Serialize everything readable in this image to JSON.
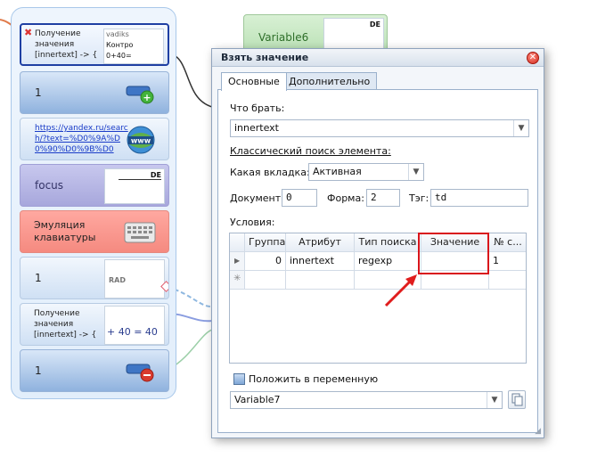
{
  "canvas": {
    "block1": {
      "label": "Получение значения [innertext] -> {",
      "preview": [
        "vadiks",
        "Контро",
        "0+40="
      ]
    },
    "block2": {
      "label": "1"
    },
    "block3": {
      "link": "https://yandex.ru/search/?text=%D0%9A%D0%90%D0%9B%D0"
    },
    "block4": {
      "label": "focus",
      "preview": "DE"
    },
    "block5": {
      "label": "Эмуляция клавиатуры"
    },
    "block6": {
      "label": "1",
      "preview": "RAD"
    },
    "block7": {
      "label": "Получение значения [innertext] -> {",
      "preview": "+ 40 = 40"
    },
    "block8": {
      "label": "1"
    },
    "variable6": {
      "label": "Variable6",
      "preview": "DE"
    }
  },
  "dialog": {
    "title": "Взять значение",
    "tabs": [
      "Основные",
      "Дополнительно"
    ],
    "what_to_take_label": "Что брать:",
    "what_to_take_value": "innertext",
    "classic_search_label": "Классический поиск элемента:",
    "which_tab_label": "Какая вкладка:",
    "which_tab_value": "Активная",
    "document_label": "Документ:",
    "document_value": "0",
    "form_label": "Форма:",
    "form_value": "2",
    "tag_label": "Тэг:",
    "tag_value": "td",
    "conditions_label": "Условия:",
    "grid": {
      "columns": [
        "Группа",
        "Атрибут",
        "Тип поиска",
        "Значение",
        "№ с..."
      ],
      "rows": [
        [
          "0",
          "innertext",
          "regexp",
          "",
          "1"
        ]
      ]
    },
    "put_in_variable_label": "Положить в переменную",
    "variable_value": "Variable7"
  }
}
